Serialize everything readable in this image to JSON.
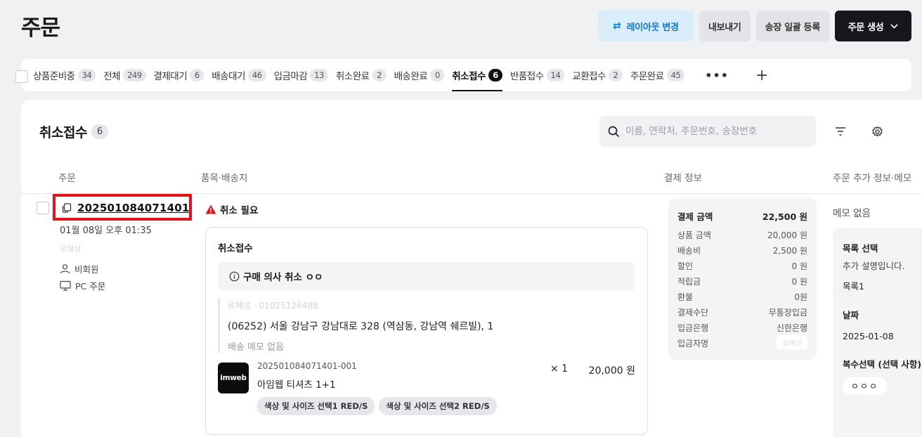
{
  "header": {
    "title": "주문",
    "layout_label": "레이아웃 변경",
    "export_label": "내보내기",
    "bulk_label": "송장 일괄 등록",
    "create_label": "주문 생성",
    "accent_color": "#1377c9"
  },
  "tabs": [
    {
      "label": "상품준비중",
      "count": "34"
    },
    {
      "label": "전체",
      "count": "249"
    },
    {
      "label": "결제대기",
      "count": "6"
    },
    {
      "label": "배송대기",
      "count": "46"
    },
    {
      "label": "입금마감",
      "count": "13"
    },
    {
      "label": "취소완료",
      "count": "2"
    },
    {
      "label": "배송완료",
      "count": "0"
    },
    {
      "label": "취소접수",
      "count": "6",
      "active": true
    },
    {
      "label": "반품접수",
      "count": "14"
    },
    {
      "label": "교환접수",
      "count": "2"
    },
    {
      "label": "주문완료",
      "count": "45"
    }
  ],
  "tab_more": "•••",
  "tab_add": "+",
  "panel": {
    "title": "취소접수",
    "count": "6",
    "search_placeholder": "이름, 연락처, 주문번호, 송장번호"
  },
  "columns": {
    "order": "주문",
    "items": "품목·배송지",
    "payment": "결제 정보",
    "extra": "주문 추가 정보·메모"
  },
  "order": {
    "number": "202501084071401",
    "date": "01월 08일 오후 01:35",
    "name": "유혜성",
    "member": "비회원",
    "channel": "PC 주문",
    "alert": "취소 필요",
    "card_title": "취소접수",
    "reason": "구매 의사 취소 ㅇㅇ",
    "recipient": "유혜성 · 01025126488",
    "address": "(06252) 서울 강남구 강남대로 328 (역삼동, 강남역 쉐르빌), 1",
    "delivery_memo": "배송 메모 없음",
    "product": {
      "logo": "imweb",
      "code": "202501084071401-001",
      "name": "아임웹 티셔츠 1+1",
      "qty": "× 1",
      "price": "20,000 원",
      "options": [
        "색상 및 사이즈 선택1 RED/S",
        "색상 및 사이즈 선택2 RED/S"
      ]
    }
  },
  "payment": {
    "total_label": "결제 금액",
    "total": "22,500 원",
    "rows": [
      {
        "label": "상품 금액",
        "value": "20,000 원"
      },
      {
        "label": "배송비",
        "value": "2,500 원"
      },
      {
        "label": "할인",
        "value": "0 원"
      },
      {
        "label": "적립금",
        "value": "0 원"
      },
      {
        "label": "환불",
        "value": "0원"
      },
      {
        "label": "결제수단",
        "value": "무통장입금"
      },
      {
        "label": "입금은행",
        "value": "신한은행"
      }
    ],
    "depositor_label": "입금자명",
    "depositor": "유혜성"
  },
  "extra": {
    "memo": "메모 없음",
    "list_label": "목록 선택",
    "list_desc": "추가 설명입니다.",
    "list_value": "목록1",
    "date_label": "날짜",
    "date_value": "2025-01-08",
    "multi_label": "복수선택 (선택 사항)",
    "multi_value": "ㅇㅇㅇ"
  },
  "colors": {
    "alert": "#e0141a",
    "highlight": "#e0141a"
  }
}
